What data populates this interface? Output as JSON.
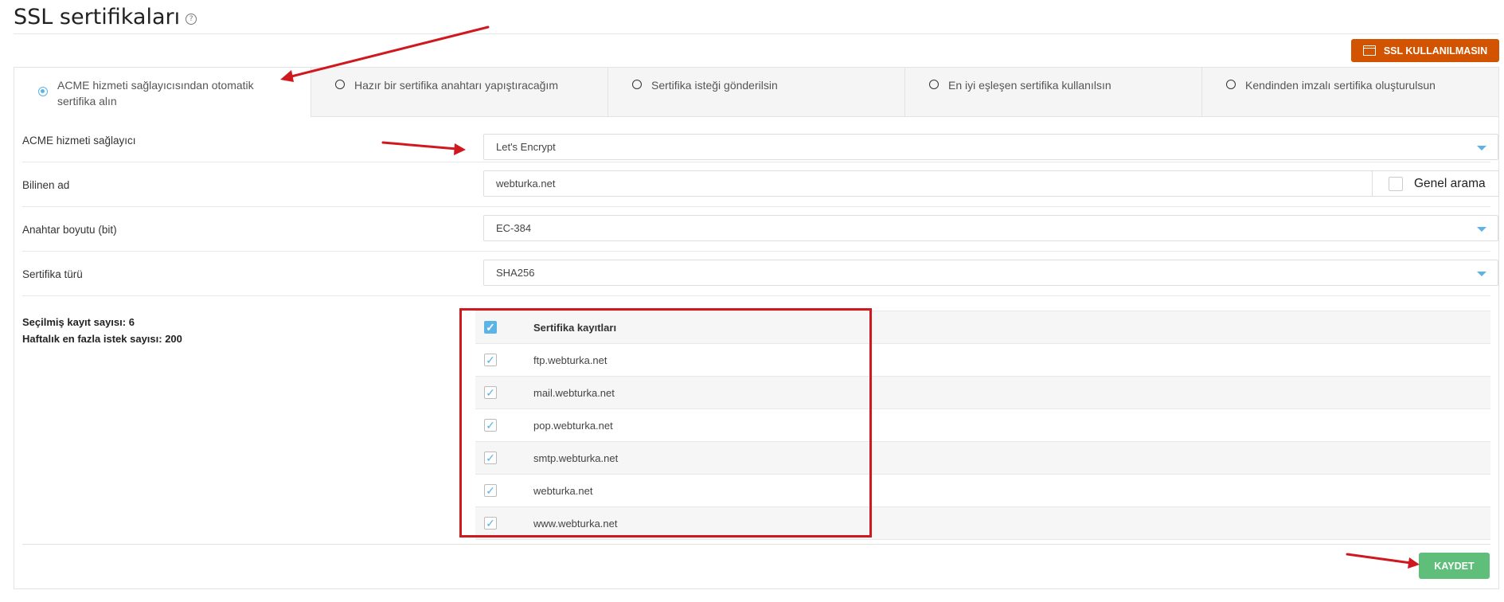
{
  "page": {
    "title": "SSL sertifikaları",
    "help_icon": "?"
  },
  "actions": {
    "disable_ssl_label": "SSL KULLANILMASIN",
    "save_label": "KAYDET"
  },
  "tabs": [
    {
      "label": "ACME hizmeti sağlayıcısından otomatik sertifika alın",
      "selected": true
    },
    {
      "label": "Hazır bir sertifika anahtarı yapıştıracağım",
      "selected": false
    },
    {
      "label": "Sertifika isteği gönderilsin",
      "selected": false
    },
    {
      "label": "En iyi eşleşen sertifika kullanılsın",
      "selected": false
    },
    {
      "label": "Kendinden imzalı sertifika oluşturulsun",
      "selected": false
    }
  ],
  "form": {
    "provider": {
      "label": "ACME hizmeti sağlayıcı",
      "value": "Let's Encrypt"
    },
    "common_name": {
      "label": "Bilinen ad",
      "value": "webturka.net",
      "general_search_label": "Genel arama"
    },
    "key_size": {
      "label": "Anahtar boyutu (bit)",
      "value": "EC-384"
    },
    "cert_type": {
      "label": "Sertifika türü",
      "value": "SHA256"
    }
  },
  "stats": {
    "selected_records": "Seçilmiş kayıt sayısı: 6",
    "weekly_limit": "Haftalık en fazla istek sayısı: 200"
  },
  "records": {
    "header": "Sertifika kayıtları",
    "items": [
      {
        "name": "ftp.webturka.net",
        "checked": true
      },
      {
        "name": "mail.webturka.net",
        "checked": true
      },
      {
        "name": "pop.webturka.net",
        "checked": true
      },
      {
        "name": "smtp.webturka.net",
        "checked": true
      },
      {
        "name": "webturka.net",
        "checked": true
      },
      {
        "name": "www.webturka.net",
        "checked": true
      }
    ]
  },
  "colors": {
    "accent": "#5cb3e6",
    "danger_button": "#d35400",
    "success_button": "#5fbf7a",
    "annotation": "#d0191e"
  }
}
